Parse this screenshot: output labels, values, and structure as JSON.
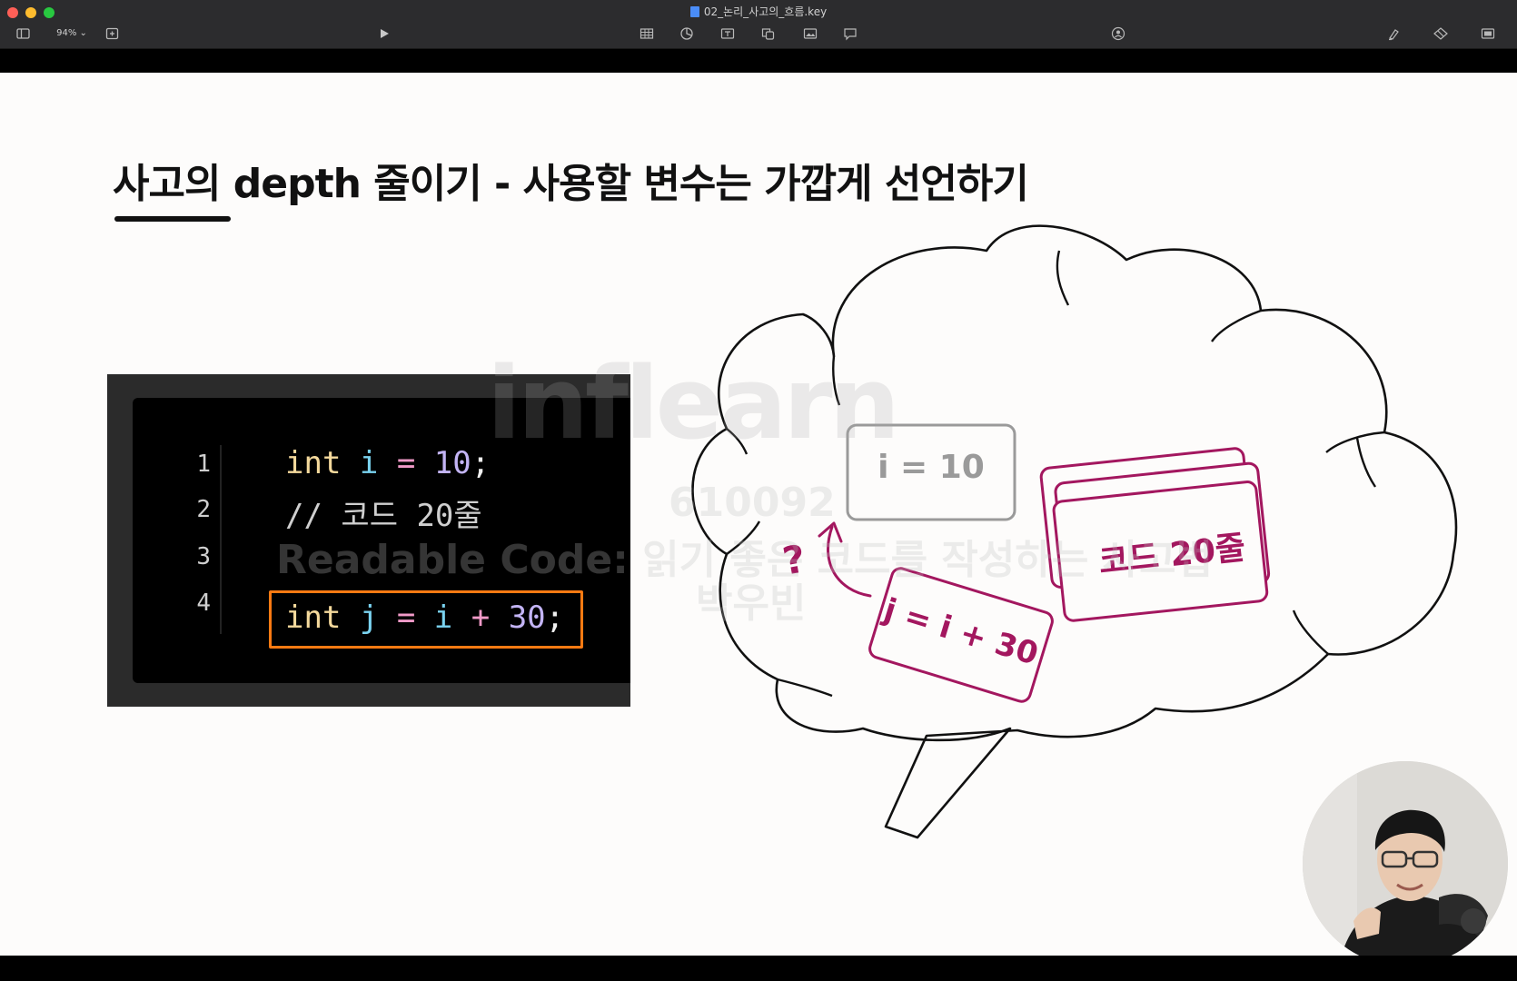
{
  "window": {
    "title": "02_논리_사고의_흐름.key",
    "zoom": "94%"
  },
  "toolbar": {
    "icons": [
      "sidebar-icon",
      "add-slide-icon",
      "play-icon",
      "table-icon",
      "chart-icon",
      "text-icon",
      "shape-icon",
      "media-icon",
      "comment-icon",
      "collaborate-icon",
      "format-icon",
      "animate-icon",
      "document-icon"
    ]
  },
  "slide": {
    "title": "사고의 depth 줄이기 - 사용할 변수는 가깝게 선언하기",
    "code": {
      "line_numbers": [
        "1",
        "2",
        "3",
        "4"
      ],
      "lines": [
        [
          {
            "t": "int",
            "c": "kw"
          },
          {
            "t": " i",
            "c": "var"
          },
          {
            "t": " =",
            "c": "op"
          },
          {
            "t": " 10",
            "c": "num"
          },
          {
            "t": ";",
            "c": "punc"
          }
        ],
        [
          {
            "t": "// 코드 20줄",
            "c": "cmt"
          }
        ],
        [],
        [
          {
            "t": "int",
            "c": "kw"
          },
          {
            "t": " j",
            "c": "var"
          },
          {
            "t": " =",
            "c": "op"
          },
          {
            "t": " i",
            "c": "var"
          },
          {
            "t": " +",
            "c": "op"
          },
          {
            "t": " 30",
            "c": "num"
          },
          {
            "t": ";",
            "c": "punc"
          }
        ]
      ],
      "highlight_color": "#ff7a12"
    },
    "diagram": {
      "card_i": "i = 10",
      "card_code": "코드 20줄",
      "card_j": "j = i + 30",
      "question": "?",
      "accent_color": "#a3175f",
      "gray_color": "#9a9a9a"
    },
    "watermark": {
      "logo": "inflearn",
      "id": "610092",
      "course": "Readable Code: 읽기 좋은 코드를 작성하는 사고법",
      "author": "박우빈"
    }
  }
}
